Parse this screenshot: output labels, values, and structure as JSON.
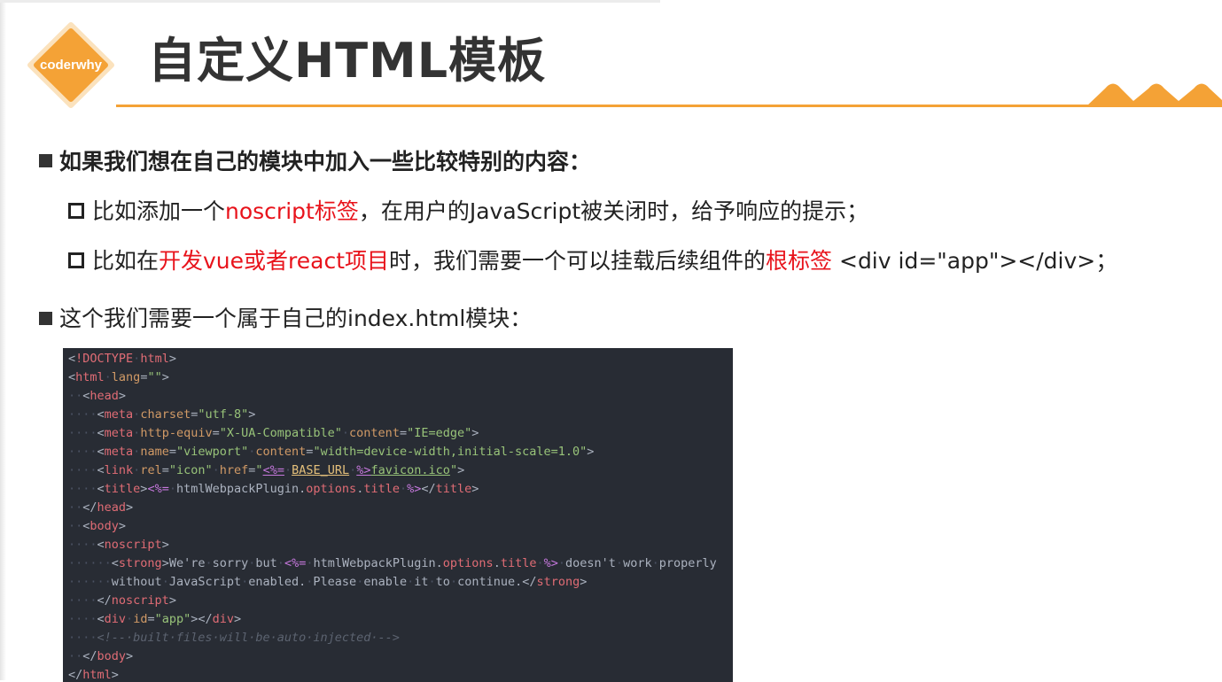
{
  "brand": {
    "logo_text": "coderwhy",
    "accent_color": "#f4a236"
  },
  "slide": {
    "title": "自定义HTML模板"
  },
  "bullets": [
    {
      "parts": [
        "如果我们想在自己的模块中加入一些比较特别的内容："
      ]
    },
    {
      "parts": [
        "比如添加一个",
        "noscript标签",
        "，在用户的JavaScript被关闭时，给予响应的提示；"
      ]
    },
    {
      "parts": [
        "比如在",
        "开发vue或者react项目",
        "时，我们需要一个可以挂载后续组件的",
        "根标签",
        " <div id=\"app\"></div>；"
      ]
    },
    {
      "parts": [
        "这个我们需要一个属于自己的index.html模块："
      ]
    }
  ],
  "code": {
    "lines": [
      "<!DOCTYPE html>",
      "<html lang=\"\">",
      "  <head>",
      "    <meta charset=\"utf-8\">",
      "    <meta http-equiv=\"X-UA-Compatible\" content=\"IE=edge\">",
      "    <meta name=\"viewport\" content=\"width=device-width,initial-scale=1.0\">",
      "    <link rel=\"icon\" href=\"<%= BASE_URL %>favicon.ico\">",
      "    <title><%= htmlWebpackPlugin.options.title %></title>",
      "  </head>",
      "  <body>",
      "    <noscript>",
      "      <strong>We're sorry but <%= htmlWebpackPlugin.options.title %> doesn't work properly",
      "      without JavaScript enabled. Please enable it to continue.</strong>",
      "    </noscript>",
      "    <div id=\"app\"></div>",
      "    <!-- built files will be auto injected -->",
      "  </body>",
      "</html>"
    ]
  }
}
